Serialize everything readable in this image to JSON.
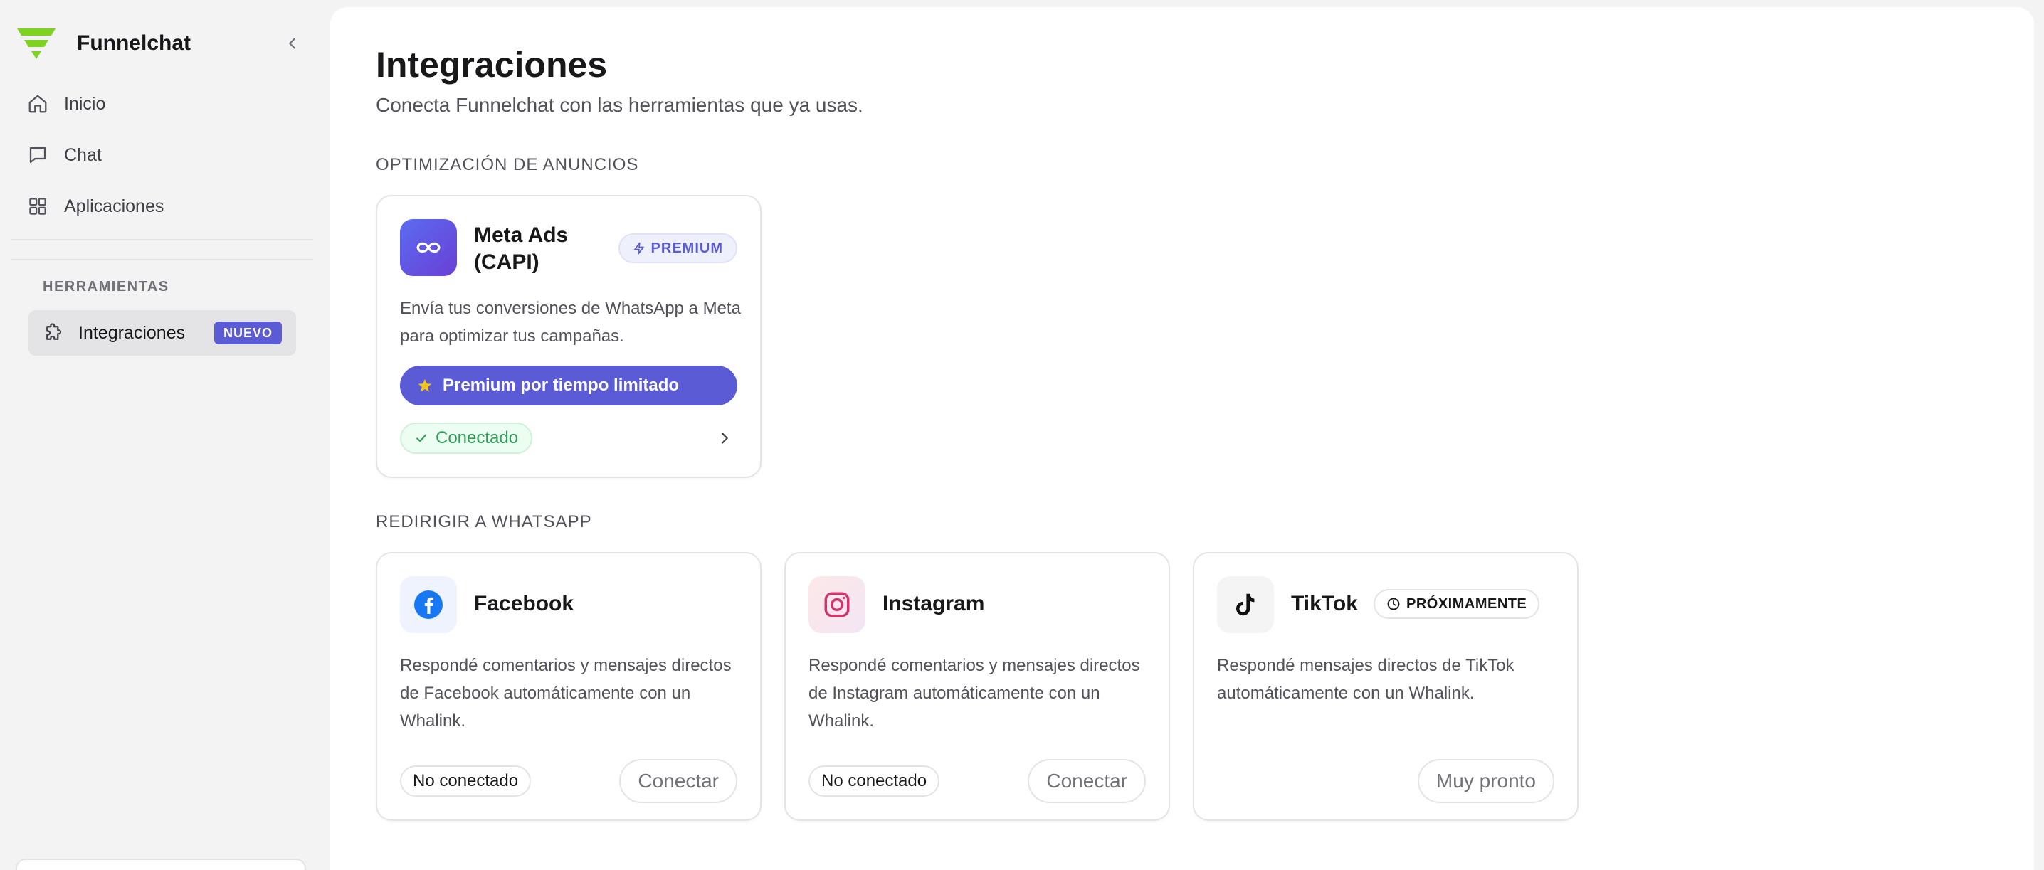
{
  "app": {
    "name": "Funnelchat"
  },
  "sidebar": {
    "items": [
      {
        "label": "Inicio",
        "icon": "home-icon"
      },
      {
        "label": "Chat",
        "icon": "chat-icon"
      },
      {
        "label": "Aplicaciones",
        "icon": "apps-grid-icon"
      }
    ],
    "section_label": "HERRAMIENTAS",
    "active_item": {
      "label": "Integraciones",
      "icon": "puzzle-icon",
      "badge": "NUEVO"
    }
  },
  "page": {
    "title": "Integraciones",
    "subtitle": "Conecta Funnelchat con las herramientas que ya usas."
  },
  "groups": [
    {
      "title": "OPTIMIZACIÓN DE ANUNCIOS",
      "cards": [
        {
          "title_line1": "Meta Ads",
          "title_line2": "(CAPI)",
          "badge": "PREMIUM",
          "description": "Envía tus conversiones de WhatsApp a Meta para optimizar tus campañas.",
          "cta": "Premium por tiempo limitado",
          "status": "Conectado"
        }
      ]
    },
    {
      "title": "REDIRIGIR A WHATSAPP",
      "cards": [
        {
          "title": "Facebook",
          "description": "Respondé comentarios y mensajes directos de Facebook automáticamente con un Whalink.",
          "status": "No conectado",
          "action": "Conectar"
        },
        {
          "title": "Instagram",
          "description": "Respondé comentarios y mensajes directos de Instagram automáticamente con un Whalink.",
          "status": "No conectado",
          "action": "Conectar"
        },
        {
          "title": "TikTok",
          "badge": "PRÓXIMAMENTE",
          "description": "Respondé mensajes directos de TikTok automáticamente con un Whalink.",
          "action": "Muy pronto"
        }
      ]
    }
  ],
  "colors": {
    "accent": "#5b5bd6",
    "brand_green": "#7ed321",
    "success": "#2e9e58",
    "sidebar_bg": "#f3f3f4"
  }
}
